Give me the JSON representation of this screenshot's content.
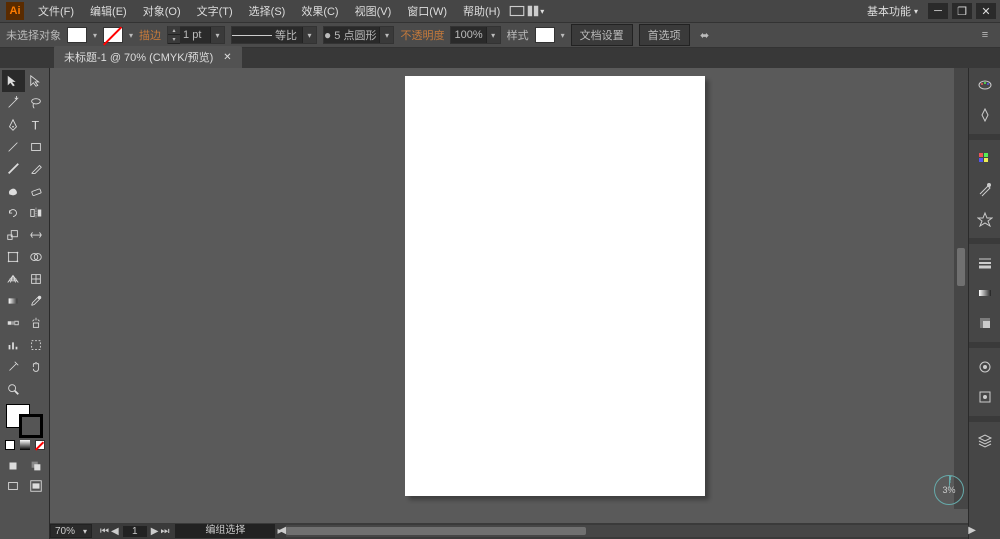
{
  "app": {
    "logo": "Ai",
    "workspace": "基本功能"
  },
  "menu": [
    "文件(F)",
    "编辑(E)",
    "对象(O)",
    "文字(T)",
    "选择(S)",
    "效果(C)",
    "视图(V)",
    "窗口(W)",
    "帮助(H)"
  ],
  "control": {
    "selection": "未选择对象",
    "stroke_label": "描边",
    "stroke_pt": "1 pt",
    "style_name": "等比",
    "brush_size": "5 点圆形",
    "opacity_label": "不透明度",
    "opacity_val": "100%",
    "style_label": "样式",
    "doc_setup": "文档设置",
    "prefs": "首选项"
  },
  "tab": {
    "title": "未标题-1 @ 70% (CMYK/预览)"
  },
  "status": {
    "zoom": "70%",
    "page": "1",
    "label": "编组选择"
  },
  "progress": "3%",
  "panel_icons": [
    "color",
    "color-guide",
    "swatches",
    "brushes",
    "symbols",
    "stroke",
    "gradient",
    "transparency",
    "appearance",
    "graphic-styles",
    "layers"
  ]
}
